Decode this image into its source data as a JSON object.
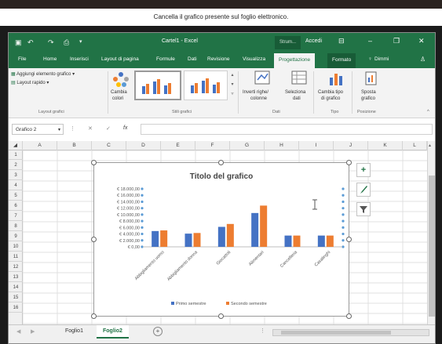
{
  "tooltip": "Cancella il grafico presente sul foglio elettronico.",
  "window": {
    "title": "Cartel1 - Excel",
    "tools_label": "Strum...",
    "login": "Accedi"
  },
  "tabs": [
    {
      "label": "File"
    },
    {
      "label": "Home"
    },
    {
      "label": "Inserisci"
    },
    {
      "label": "Layout di pagina"
    },
    {
      "label": "Formule"
    },
    {
      "label": "Dati"
    },
    {
      "label": "Revisione"
    },
    {
      "label": "Visualizza"
    },
    {
      "label": "Progettazione"
    },
    {
      "label": "Formato"
    },
    {
      "label": "Dimmi"
    }
  ],
  "ribbon": {
    "add_element": "Aggiungi elemento grafico",
    "quick_layout": "Layout rapido",
    "group_layout": "Layout grafici",
    "change_colors_1": "Cambia",
    "change_colors_2": "colori",
    "group_styles": "Stili grafici",
    "switch_row_col_1": "Inverti righe/",
    "switch_row_col_2": "colonne",
    "select_data_1": "Seleziona",
    "select_data_2": "dati",
    "group_data": "Dati",
    "change_type_1": "Cambia tipo",
    "change_type_2": "di grafico",
    "group_type": "Tipo",
    "move_chart_1": "Sposta",
    "move_chart_2": "grafico",
    "group_position": "Posizione"
  },
  "formula_bar": {
    "name_box": "Grafico 2",
    "cancel": "✕",
    "enter": "✓",
    "fx": "fx"
  },
  "columns": [
    "A",
    "B",
    "C",
    "D",
    "E",
    "F",
    "G",
    "H",
    "I",
    "J",
    "K",
    "L"
  ],
  "rows": [
    "1",
    "2",
    "3",
    "4",
    "5",
    "6",
    "7",
    "8",
    "9",
    "10",
    "11",
    "12",
    "13",
    "14",
    "15",
    "16"
  ],
  "sheets": [
    {
      "label": "Foglio1"
    },
    {
      "label": "Foglio2"
    }
  ],
  "add_sheet": "+",
  "colors": {
    "excel_green": "#217346",
    "series1": "#4472c4",
    "series2": "#ed7d31"
  },
  "chart_data": {
    "type": "bar",
    "title": "Titolo del grafico",
    "categories": [
      "Abbigliamento uomo",
      "Abbigliamento donna",
      "Giocattoli",
      "Alimentari",
      "Cancelleria",
      "Casalinghi"
    ],
    "series": [
      {
        "name": "Primo semestre",
        "values": [
          4900,
          4100,
          6200,
          10500,
          3500,
          3500
        ]
      },
      {
        "name": "Secondo semestre",
        "values": [
          5100,
          4300,
          7100,
          12800,
          3500,
          3500
        ]
      }
    ],
    "y_ticks": [
      "€ 18.000,00",
      "€ 16.000,00",
      "€ 14.000,00",
      "€ 12.000,00",
      "€ 10.000,00",
      "€ 8.000,00",
      "€ 6.000,00",
      "€ 4.000,00",
      "€ 2.000,00",
      "€ 0,00"
    ],
    "ylim": [
      0,
      18000
    ],
    "legend": "bottom",
    "grid": false
  }
}
